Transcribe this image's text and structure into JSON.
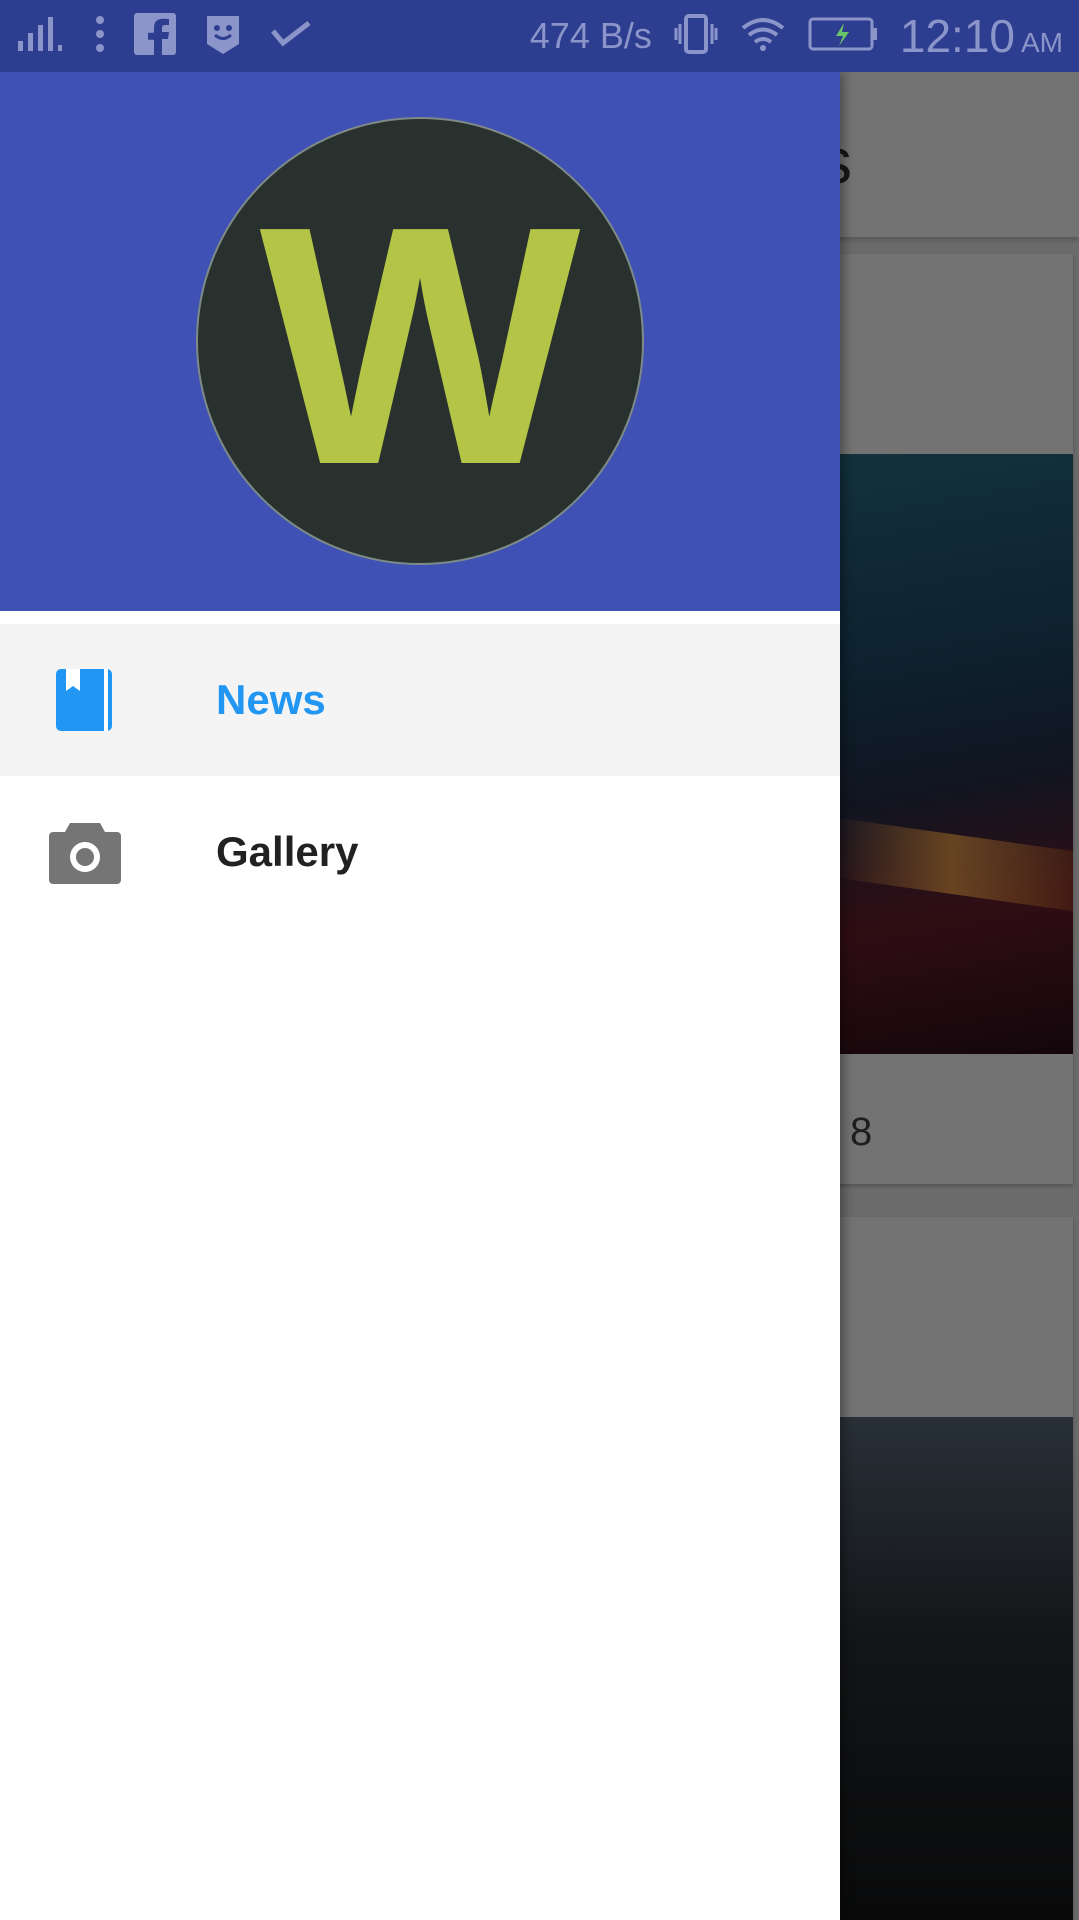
{
  "status_bar": {
    "net_speed": "474 B/s",
    "time": "12:10",
    "ampm": "AM"
  },
  "background": {
    "toolbar_title_fragment": "s",
    "card_text_fragment": "8"
  },
  "drawer": {
    "logo_letter": "W",
    "items": [
      {
        "label": "News",
        "icon": "book-icon",
        "active": true
      },
      {
        "label": "Gallery",
        "icon": "camera-icon",
        "active": false
      }
    ]
  },
  "colors": {
    "header": "#3f51b5",
    "status_bar": "#2d3d8f",
    "accent": "#2196f3",
    "logo_bg": "#29312f",
    "logo_letter": "#b3c446"
  }
}
